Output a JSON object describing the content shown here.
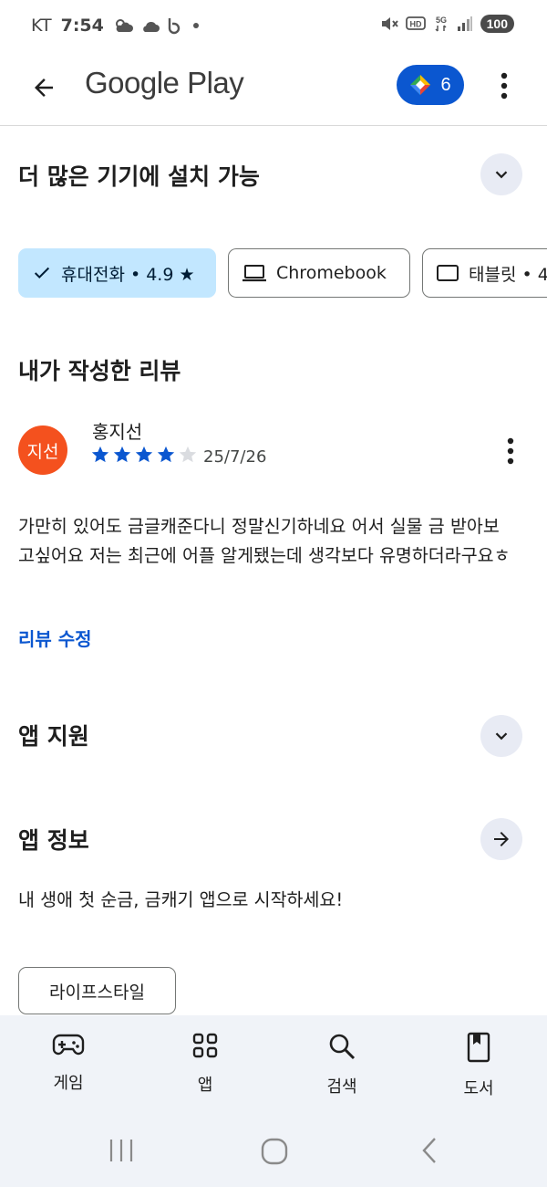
{
  "status_bar": {
    "carrier": "KT",
    "time": "7:54",
    "battery": "100"
  },
  "app_bar": {
    "title": "Google Play",
    "points": "6"
  },
  "devices_section": {
    "title": "더 많은 기기에 설치 가능",
    "chips": [
      {
        "label": "휴대전화 • 4.9 ★",
        "selected": true
      },
      {
        "label": "Chromebook",
        "selected": false
      },
      {
        "label": "태블릿 • 4",
        "selected": false
      }
    ]
  },
  "my_review": {
    "title": "내가 작성한 리뷰",
    "avatar_text": "지선",
    "reviewer": "홍지선",
    "rating": 4,
    "max_rating": 5,
    "date": "25/7/26",
    "text": "가만히 있어도 금글캐준다니 정말신기하네요 어서 실물 금 받아보고싶어요 저는 최근에 어플 알게됐는데 생각보다 유명하더라구요ㅎ",
    "edit_label": "리뷰 수정"
  },
  "app_support": {
    "title": "앱 지원"
  },
  "app_info": {
    "title": "앱 정보",
    "description": "내 생애 첫 순금, 금캐기 앱으로 시작하세요!",
    "tag": "라이프스타일"
  },
  "bottom_nav": {
    "items": [
      {
        "label": "게임",
        "icon": "gamepad-icon"
      },
      {
        "label": "앱",
        "icon": "apps-grid-icon"
      },
      {
        "label": "검색",
        "icon": "search-icon"
      },
      {
        "label": "도서",
        "icon": "book-icon"
      }
    ]
  },
  "colors": {
    "accent": "#0b57d0",
    "chip_selected": "#c2e7ff",
    "avatar": "#f4511e",
    "star_filled": "#0b57d0",
    "star_empty": "#dadce0"
  }
}
